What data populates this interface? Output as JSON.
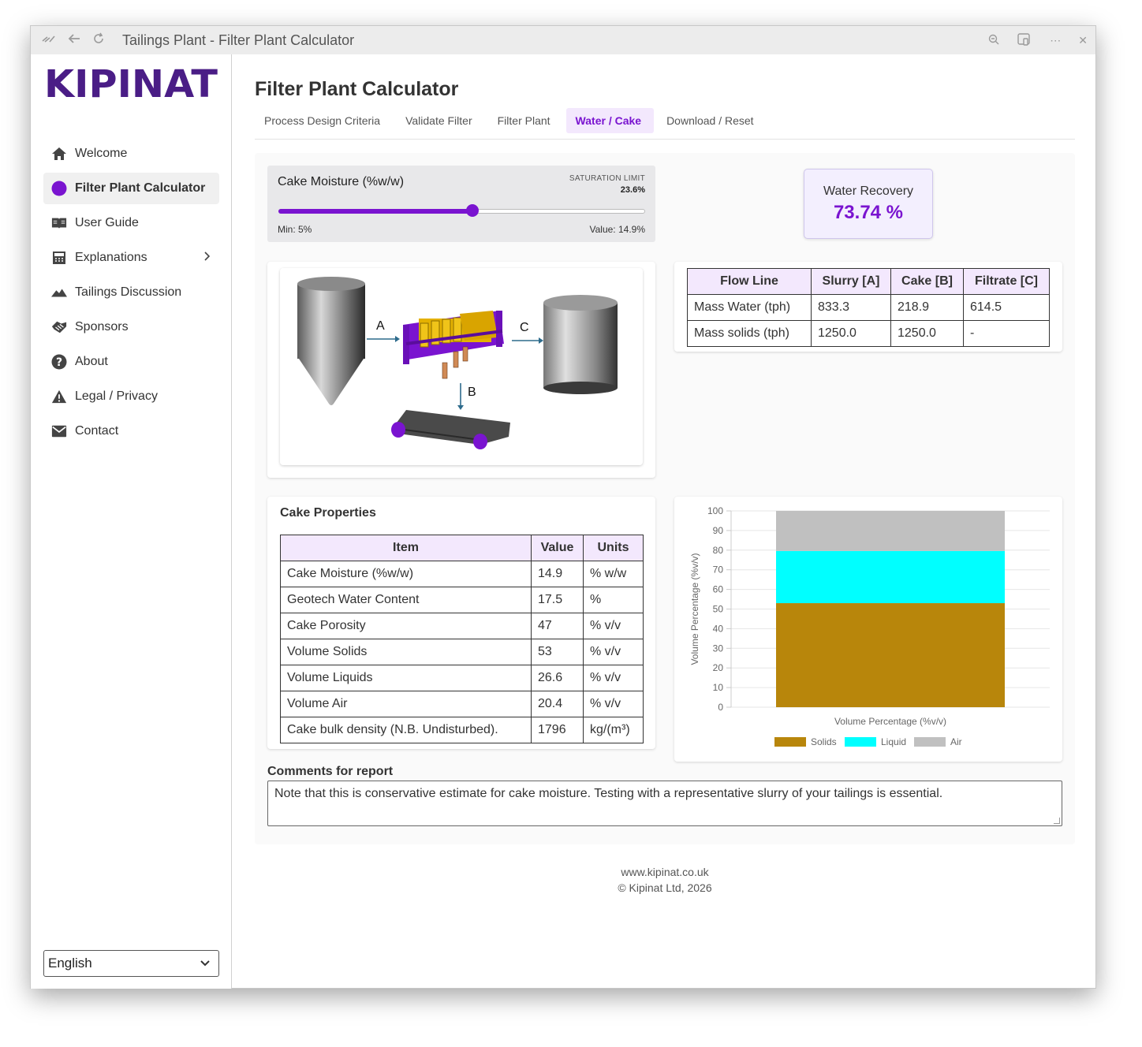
{
  "window": {
    "title": "Tailings Plant - Filter Plant Calculator"
  },
  "brand": {
    "logo_text": "KIPINAT",
    "color": "#4a1d86"
  },
  "sidebar": {
    "items": [
      {
        "label": "Welcome",
        "icon": "home-icon"
      },
      {
        "label": "Filter Plant Calculator",
        "icon": "purple-dot-icon"
      },
      {
        "label": "User Guide",
        "icon": "book-icon"
      },
      {
        "label": "Explanations",
        "icon": "calculator-icon"
      },
      {
        "label": "Tailings Discussion",
        "icon": "mountain-icon"
      },
      {
        "label": "Sponsors",
        "icon": "handshake-icon"
      },
      {
        "label": "About",
        "icon": "help-icon"
      },
      {
        "label": "Legal / Privacy",
        "icon": "warning-icon"
      },
      {
        "label": "Contact",
        "icon": "mail-icon"
      }
    ],
    "language": "English"
  },
  "page": {
    "title": "Filter Plant Calculator"
  },
  "tabs": [
    {
      "label": "Process Design Criteria"
    },
    {
      "label": "Validate Filter"
    },
    {
      "label": "Filter Plant"
    },
    {
      "label": "Water / Cake"
    },
    {
      "label": "Download / Reset"
    }
  ],
  "accent": "#7a14d0",
  "slider": {
    "label": "Cake Moisture (%w/w)",
    "limit_label": "SATURATION LIMIT",
    "limit_value": "23.6%",
    "min_text": "Min: 5%",
    "value_text": "Value: 14.9%",
    "fill_fraction": 0.53
  },
  "recovery": {
    "label": "Water Recovery",
    "value": "73.74 %"
  },
  "diagram": {
    "label_a": "A",
    "label_b": "B",
    "label_c": "C"
  },
  "flow_table": {
    "headers": [
      "Flow Line",
      "Slurry [A]",
      "Cake [B]",
      "Filtrate [C]"
    ],
    "rows": [
      [
        "Mass Water (tph)",
        "833.3",
        "218.9",
        "614.5"
      ],
      [
        "Mass solids (tph)",
        "1250.0",
        "1250.0",
        "-"
      ]
    ]
  },
  "props": {
    "title": "Cake Properties",
    "headers": [
      "Item",
      "Value",
      "Units"
    ],
    "rows": [
      [
        "Cake Moisture (%w/w)",
        "14.9",
        "% w/w"
      ],
      [
        "Geotech Water Content",
        "17.5",
        "%"
      ],
      [
        "Cake Porosity",
        "47",
        "% v/v"
      ],
      [
        "Volume Solids",
        "53",
        "% v/v"
      ],
      [
        "Volume Liquids",
        "26.6",
        "% v/v"
      ],
      [
        "Volume Air",
        "20.4",
        "% v/v"
      ],
      [
        "Cake bulk density (N.B. Undisturbed).",
        "1796",
        "kg/(m³)"
      ]
    ]
  },
  "chart_data": {
    "type": "bar",
    "stacked": true,
    "categories": [
      ""
    ],
    "series": [
      {
        "name": "Solids",
        "values": [
          53
        ],
        "color": "#b8860b"
      },
      {
        "name": "Liquid",
        "values": [
          26.6
        ],
        "color": "#00ffff"
      },
      {
        "name": "Air",
        "values": [
          20.4
        ],
        "color": "#c0c0c0"
      }
    ],
    "xlabel": "Volume Percentage (%v/v)",
    "ylabel": "Volume Percentage (%v/v)",
    "ylim": [
      0,
      100
    ],
    "yticks": [
      "0",
      "10",
      "20",
      "30",
      "40",
      "50",
      "60",
      "70",
      "80",
      "90",
      "100"
    ],
    "grid": true,
    "legend": "bottom"
  },
  "comments": {
    "label": "Comments for report",
    "text": "Note that this is conservative estimate for cake moisture. Testing with a representative slurry of your tailings is essential."
  },
  "footer": {
    "site": "www.kipinat.co.uk",
    "copyright": "© Kipinat Ltd, 2026"
  }
}
